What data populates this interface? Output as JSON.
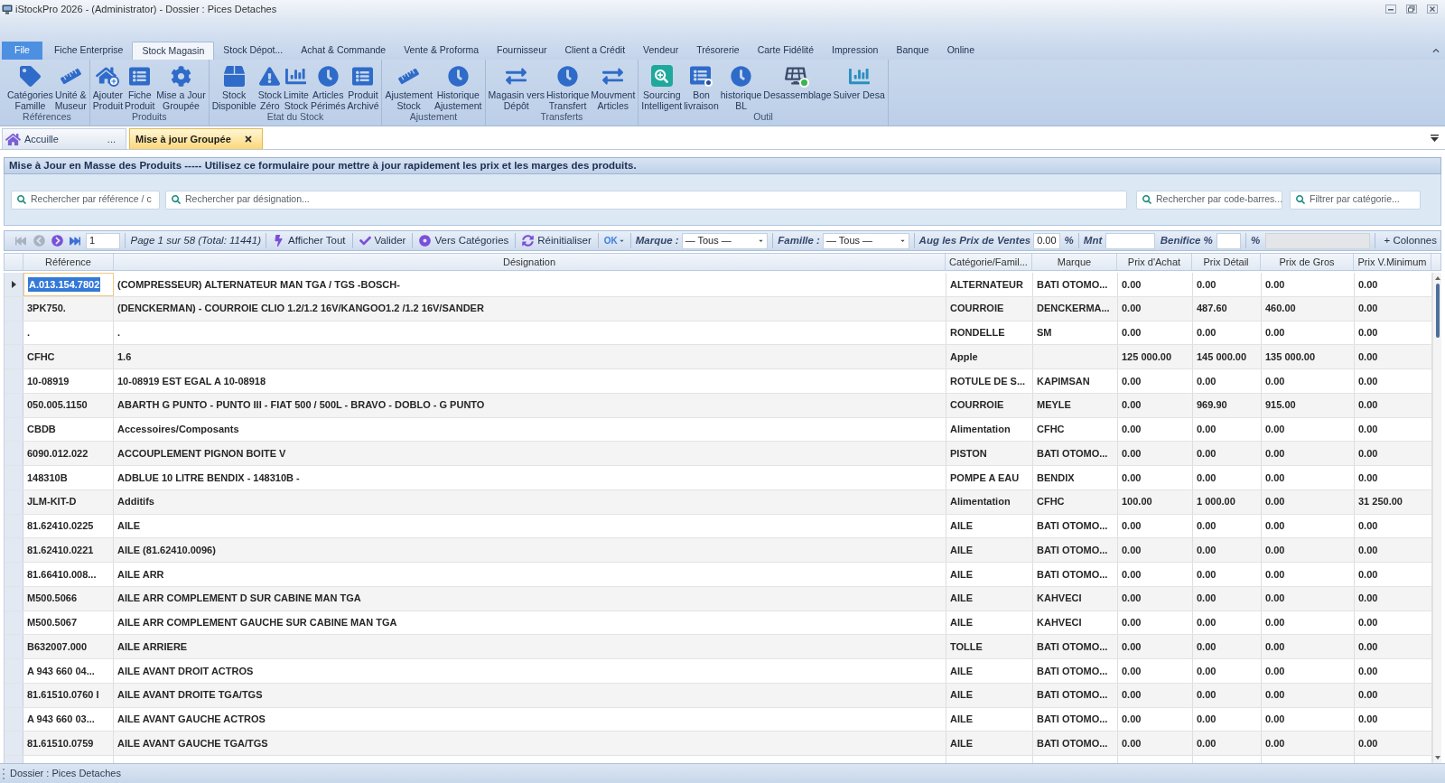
{
  "window": {
    "title": "iStockPro 2026 - (Administrator) - Dossier : Pices Detaches"
  },
  "menu_tabs": [
    {
      "label": "File",
      "kind": "app",
      "selected": false
    },
    {
      "label": "Fiche Enterprise",
      "kind": "tab",
      "selected": false
    },
    {
      "label": "Stock Magasin",
      "kind": "tab",
      "selected": true
    },
    {
      "label": "Stock Dépot...",
      "kind": "tab",
      "selected": false
    },
    {
      "label": "Achat & Commande",
      "kind": "tab",
      "selected": false
    },
    {
      "label": "Vente & Proforma",
      "kind": "tab",
      "selected": false
    },
    {
      "label": "Fournisseur",
      "kind": "tab",
      "selected": false
    },
    {
      "label": "Client a Crédit",
      "kind": "tab",
      "selected": false
    },
    {
      "label": "Vendeur",
      "kind": "tab",
      "selected": false
    },
    {
      "label": "Trésorerie",
      "kind": "tab",
      "selected": false
    },
    {
      "label": "Carte Fidélité",
      "kind": "tab",
      "selected": false
    },
    {
      "label": "Impression",
      "kind": "tab",
      "selected": false
    },
    {
      "label": "Banque",
      "kind": "tab",
      "selected": false
    },
    {
      "label": "Online",
      "kind": "tab",
      "selected": false
    }
  ],
  "ribbon": {
    "groups": [
      {
        "label": "Références",
        "buttons": [
          {
            "label": "Catégories\nFamille"
          },
          {
            "label": "Unité &\nMuseur"
          }
        ]
      },
      {
        "label": "Produits",
        "buttons": [
          {
            "label": "Ajouter\nProduit"
          },
          {
            "label": "Fiche\nProduit"
          },
          {
            "label": "Mise a Jour\nGroupée"
          }
        ]
      },
      {
        "label": "Etat du Stock",
        "buttons": [
          {
            "label": "Stock\nDisponible"
          },
          {
            "label": "Stock\nZéro"
          },
          {
            "label": "Limite\nStock"
          },
          {
            "label": "Articles\nPérimés"
          },
          {
            "label": "Produit\nArchivé"
          }
        ]
      },
      {
        "label": "Ajustement",
        "buttons": [
          {
            "label": "Ajustement\nStock"
          },
          {
            "label": "Historique\nAjustement"
          }
        ]
      },
      {
        "label": "Transferts",
        "buttons": [
          {
            "label": "Magasin vers\nDépôt"
          },
          {
            "label": "Historique\nTransfert"
          },
          {
            "label": "Mouvment\nArticles"
          }
        ]
      },
      {
        "label": "Outil",
        "buttons": [
          {
            "label": "Sourcing\nIntelligent"
          },
          {
            "label": "Bon\nlivraison"
          },
          {
            "label": "historique\nBL"
          },
          {
            "label": "Desassemblage"
          },
          {
            "label": "Suiver Desa"
          }
        ]
      }
    ]
  },
  "document_tabs": [
    {
      "label": "Accuille",
      "selected": false,
      "closable": false,
      "overflow": "..."
    },
    {
      "label": "Mise à jour Groupée",
      "selected": true,
      "closable": true
    }
  ],
  "form": {
    "title": "Mise à Jour en Masse des Produits ----- Utilisez ce formulaire pour mettre à jour rapidement les prix et les marges des produits.",
    "search_fields": [
      {
        "placeholder": "Rechercher par référence / c"
      },
      {
        "placeholder": "Rechercher par désignation..."
      },
      {
        "placeholder": "Rechercher par code-barres..."
      },
      {
        "placeholder": "Filtrer par catégorie..."
      }
    ]
  },
  "toolbar": {
    "nav_buttons": [
      {
        "kind": "first",
        "disabled": true
      },
      {
        "kind": "previous",
        "disabled": true
      },
      {
        "kind": "next",
        "disabled": false
      },
      {
        "kind": "last",
        "disabled": false
      }
    ],
    "page_input": "1",
    "page_info": "Page 1 sur 58 (Total: 11441)",
    "actions": [
      {
        "label": "Afficher Tout",
        "kind": "show_all"
      },
      {
        "label": "Valider",
        "kind": "validate"
      },
      {
        "label": "Vers Catégories",
        "kind": "categories"
      },
      {
        "label": "Réinitialiser",
        "kind": "reset"
      }
    ],
    "ok_menu": "OK",
    "filters": [
      {
        "label": "Marque :",
        "value": "— Tous —"
      },
      {
        "label": "Famille :",
        "value": "— Tous —"
      }
    ],
    "price_increase": {
      "label": "Aug les Prix de Ventes",
      "value": "0.00",
      "unit": "%"
    },
    "amount": {
      "label": "Mnt"
    },
    "profit": {
      "label": "Benifice %",
      "unit": "%",
      "result_disabled": true
    },
    "columns_button": "+ Colonnes"
  },
  "table": {
    "columns": [
      "Référence",
      "Désignation",
      "Catégorie/Famil...",
      "Marque",
      "Prix d'Achat",
      "Prix Détail",
      "Prix de Gros",
      "Prix V.Minimum"
    ],
    "rows": [
      {
        "selected": true,
        "reference": "A.013.154.7802",
        "designation": "(COMPRESSEUR) ALTERNATEUR MAN TGA / TGS -BOSCH-",
        "category": "ALTERNATEUR",
        "brand": "BATI OTOMO...",
        "purchase_price": "0.00",
        "retail_price": "0.00",
        "wholesale_price": "0.00",
        "minimum_price": "0.00"
      },
      {
        "selected": false,
        "reference": "3PK750.",
        "designation": "(DENCKERMAN) - COURROIE CLIO 1.2/1.2 16V/KANGOO1.2 /1.2 16V/SANDER",
        "category": "COURROIE",
        "brand": "DENCKERMA...",
        "purchase_price": "0.00",
        "retail_price": "487.60",
        "wholesale_price": "460.00",
        "minimum_price": "0.00"
      },
      {
        "selected": false,
        "reference": ".",
        "designation": ".",
        "category": "RONDELLE",
        "brand": "SM",
        "purchase_price": "0.00",
        "retail_price": "0.00",
        "wholesale_price": "0.00",
        "minimum_price": "0.00"
      },
      {
        "selected": false,
        "reference": "CFHC",
        "designation": "1.6",
        "category": "Apple",
        "purchase_price": "125 000.00",
        "retail_price": "145 000.00",
        "wholesale_price": "135 000.00",
        "minimum_price": "0.00"
      },
      {
        "selected": false,
        "reference": "10-08919",
        "designation": "10-08919 EST EGAL A 10-08918",
        "category": "ROTULE DE S...",
        "brand": "KAPIMSAN",
        "purchase_price": "0.00",
        "retail_price": "0.00",
        "wholesale_price": "0.00",
        "minimum_price": "0.00"
      },
      {
        "selected": false,
        "reference": "050.005.1150",
        "designation": "ABARTH G PUNTO - PUNTO III - FIAT 500 / 500L - BRAVO - DOBLO - G PUNTO",
        "category": "COURROIE",
        "brand": "MEYLE",
        "purchase_price": "0.00",
        "retail_price": "969.90",
        "wholesale_price": "915.00",
        "minimum_price": "0.00"
      },
      {
        "selected": false,
        "reference": "CBDB",
        "designation": "Accessoires/Composants",
        "category": "Alimentation",
        "brand": "CFHC",
        "purchase_price": "0.00",
        "retail_price": "0.00",
        "wholesale_price": "0.00",
        "minimum_price": "0.00"
      },
      {
        "selected": false,
        "reference": "6090.012.022",
        "designation": "ACCOUPLEMENT PIGNON BOITE V",
        "category": "PISTON",
        "brand": "BATI OTOMO...",
        "purchase_price": "0.00",
        "retail_price": "0.00",
        "wholesale_price": "0.00",
        "minimum_price": "0.00"
      },
      {
        "selected": false,
        "reference": "148310B",
        "designation": "ADBLUE 10 LITRE BENDIX - 148310B -",
        "category": "POMPE A EAU",
        "brand": "BENDIX",
        "purchase_price": "0.00",
        "retail_price": "0.00",
        "wholesale_price": "0.00",
        "minimum_price": "0.00"
      },
      {
        "selected": false,
        "reference": "JLM-KIT-D",
        "designation": "Additifs",
        "category": "Alimentation",
        "brand": "CFHC",
        "purchase_price": "100.00",
        "retail_price": "1 000.00",
        "wholesale_price": "0.00",
        "minimum_price": "31 250.00"
      },
      {
        "selected": false,
        "reference": "81.62410.0225",
        "designation": "AILE",
        "category": "AILE",
        "brand": "BATI OTOMO...",
        "purchase_price": "0.00",
        "retail_price": "0.00",
        "wholesale_price": "0.00",
        "minimum_price": "0.00"
      },
      {
        "selected": false,
        "reference": "81.62410.0221",
        "designation": "AILE (81.62410.0096)",
        "category": "AILE",
        "brand": "BATI OTOMO...",
        "purchase_price": "0.00",
        "retail_price": "0.00",
        "wholesale_price": "0.00",
        "minimum_price": "0.00"
      },
      {
        "selected": false,
        "reference": "81.66410.008...",
        "designation": "AILE ARR",
        "category": "AILE",
        "brand": "BATI OTOMO...",
        "purchase_price": "0.00",
        "retail_price": "0.00",
        "wholesale_price": "0.00",
        "minimum_price": "0.00"
      },
      {
        "selected": false,
        "reference": "M500.5066",
        "designation": "AILE ARR COMPLEMENT D SUR CABINE MAN TGA",
        "category": "AILE",
        "brand": "KAHVECI",
        "purchase_price": "0.00",
        "retail_price": "0.00",
        "wholesale_price": "0.00",
        "minimum_price": "0.00"
      },
      {
        "selected": false,
        "reference": "M500.5067",
        "designation": "AILE ARR COMPLEMENT GAUCHE SUR CABINE MAN TGA",
        "category": "AILE",
        "brand": "KAHVECI",
        "purchase_price": "0.00",
        "retail_price": "0.00",
        "wholesale_price": "0.00",
        "minimum_price": "0.00"
      },
      {
        "selected": false,
        "reference": "B632007.000",
        "designation": "AILE ARRIERE",
        "category": "TOLLE",
        "brand": "BATI OTOMO...",
        "purchase_price": "0.00",
        "retail_price": "0.00",
        "wholesale_price": "0.00",
        "minimum_price": "0.00"
      },
      {
        "selected": false,
        "reference": "A 943 660 04...",
        "designation": "AILE AVANT DROIT ACTROS",
        "category": "AILE",
        "brand": "BATI OTOMO...",
        "purchase_price": "0.00",
        "retail_price": "0.00",
        "wholesale_price": "0.00",
        "minimum_price": "0.00"
      },
      {
        "selected": false,
        "reference": "81.61510.0760 I",
        "designation": "AILE AVANT DROITE TGA/TGS",
        "category": "AILE",
        "brand": "BATI OTOMO...",
        "purchase_price": "0.00",
        "retail_price": "0.00",
        "wholesale_price": "0.00",
        "minimum_price": "0.00"
      },
      {
        "selected": false,
        "reference": "A 943 660 03...",
        "designation": "AILE AVANT GAUCHE ACTROS",
        "category": "AILE",
        "brand": "BATI OTOMO...",
        "purchase_price": "0.00",
        "retail_price": "0.00",
        "wholesale_price": "0.00",
        "minimum_price": "0.00"
      },
      {
        "selected": false,
        "reference": "81.61510.0759",
        "designation": "AILE AVANT GAUCHE TGA/TGS",
        "category": "AILE",
        "brand": "BATI OTOMO...",
        "purchase_price": "0.00",
        "retail_price": "0.00",
        "wholesale_price": "0.00",
        "minimum_price": "0.00"
      }
    ]
  },
  "status_bar": {
    "text": "Dossier : Pices Detaches"
  }
}
